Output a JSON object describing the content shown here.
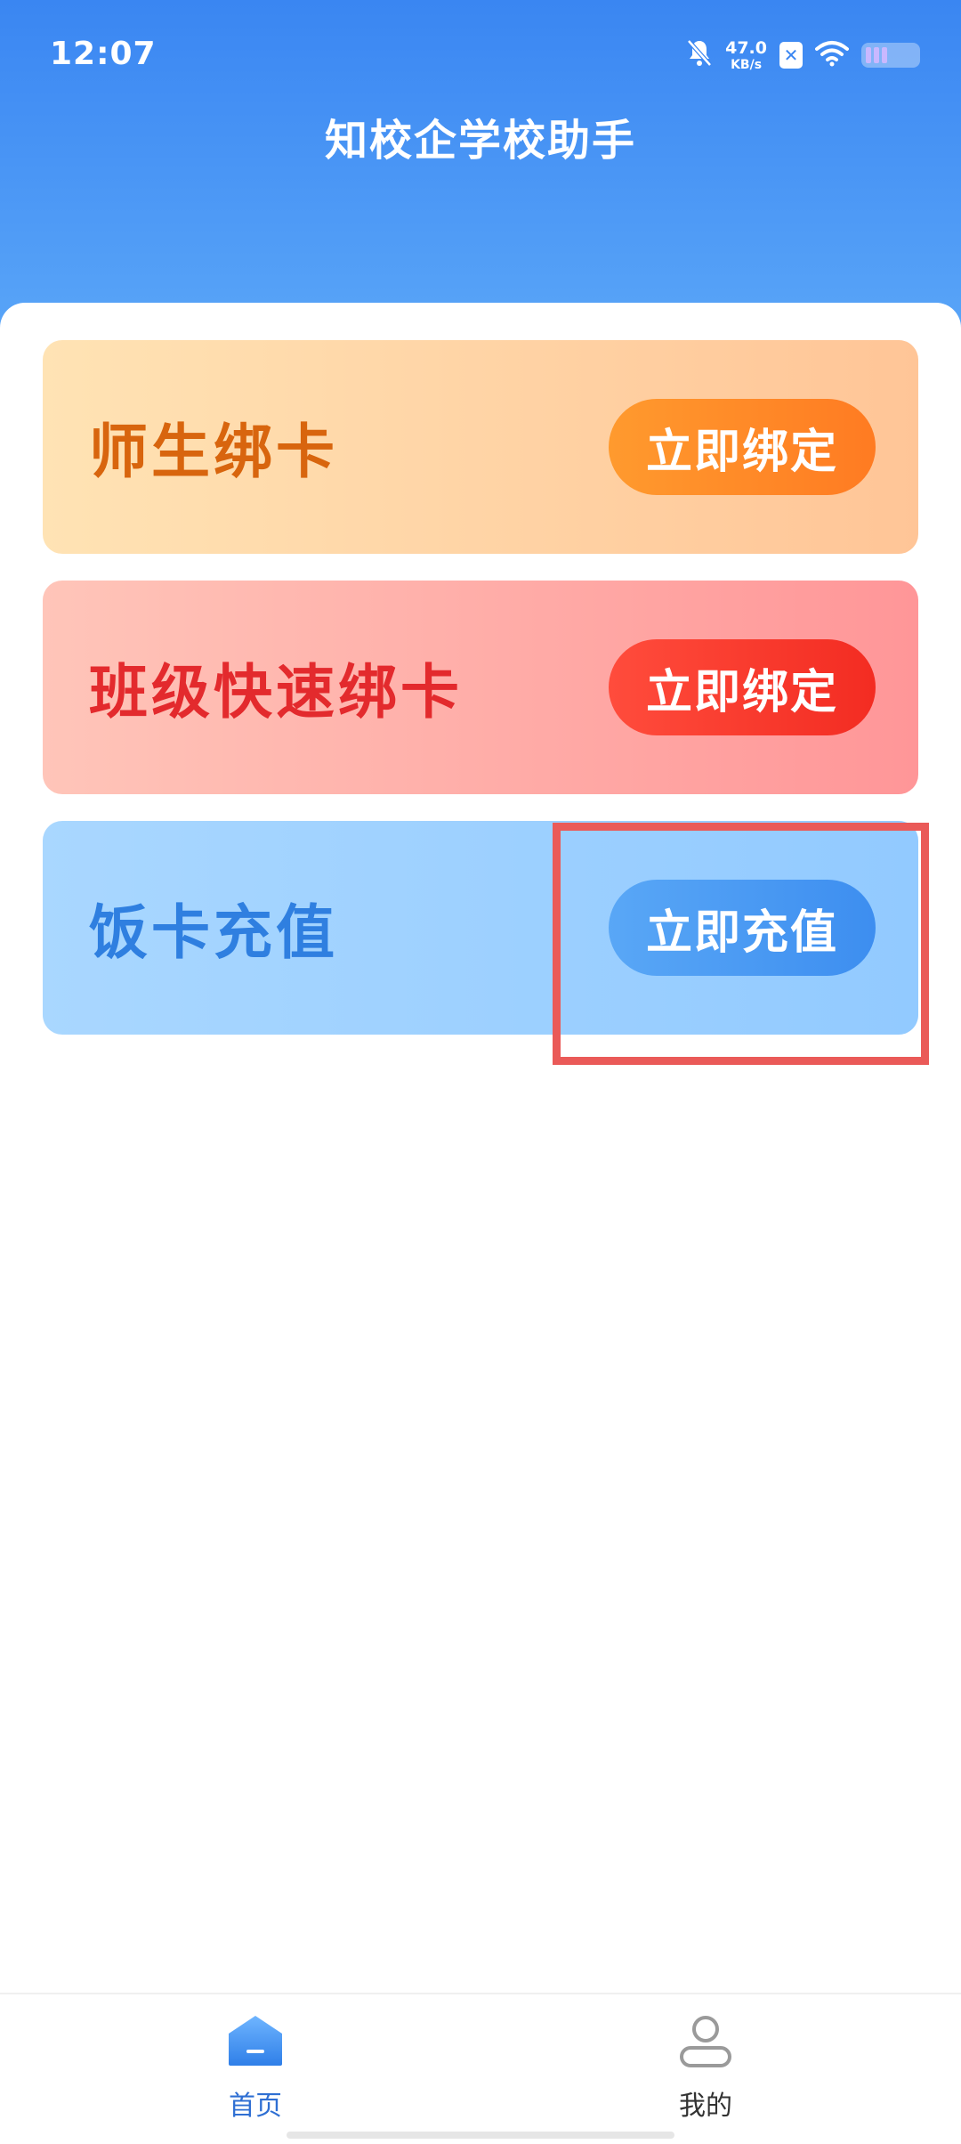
{
  "status_bar": {
    "time": "12:07",
    "net_speed_value": "47.0",
    "net_speed_unit": "KB/s",
    "icons": [
      "bell-muted-icon",
      "sim-x-icon",
      "wifi-icon",
      "battery-icon"
    ]
  },
  "header": {
    "title": "知校企学校助手"
  },
  "cards": [
    {
      "title": "师生绑卡",
      "button_label": "立即绑定",
      "accent": "#d8650e"
    },
    {
      "title": "班级快速绑卡",
      "button_label": "立即绑定",
      "accent": "#e32a2d"
    },
    {
      "title": "饭卡充值",
      "button_label": "立即充值",
      "accent": "#2f7fe0"
    }
  ],
  "bottom_nav": {
    "items": [
      {
        "label": "首页",
        "icon": "home-icon",
        "active": true
      },
      {
        "label": "我的",
        "icon": "user-icon",
        "active": false
      }
    ]
  },
  "colors": {
    "header_top": "#3a86f2",
    "highlight": "#ea5a58",
    "nav_active": "#2f6fd3"
  }
}
